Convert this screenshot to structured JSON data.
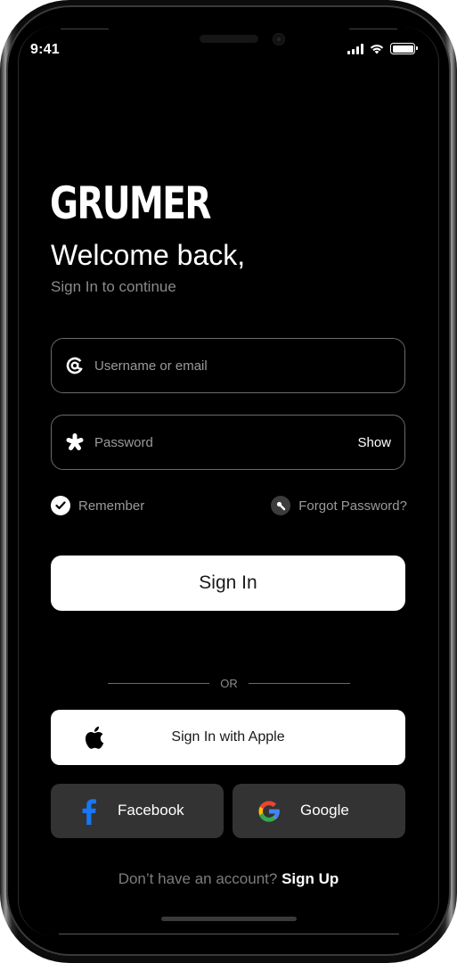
{
  "status_bar": {
    "time": "9:41",
    "icons": [
      "cellular-signal-icon",
      "wifi-icon",
      "battery-icon"
    ]
  },
  "brand": {
    "logo_text": "GRUMER"
  },
  "header": {
    "title": "Welcome back,",
    "subtitle": "Sign In to continue"
  },
  "form": {
    "username": {
      "placeholder": "Username or email",
      "value": "",
      "icon": "at-sign-icon"
    },
    "password": {
      "placeholder": "Password",
      "value": "",
      "icon": "asterisk-icon",
      "toggle_label": "Show"
    },
    "remember": {
      "label": "Remember",
      "checked": true,
      "icon": "check-circle-icon"
    },
    "forgot": {
      "label": "Forgot Password?",
      "icon": "key-icon"
    },
    "submit_label": "Sign In"
  },
  "divider": {
    "label": "OR"
  },
  "social": {
    "apple": {
      "label": "Sign In with Apple",
      "icon": "apple-icon"
    },
    "facebook": {
      "label": "Facebook",
      "icon": "facebook-icon",
      "color": "#1877F2"
    },
    "google": {
      "label": "Google",
      "icon": "google-icon",
      "colors": [
        "#4285F4",
        "#34A853",
        "#FBBC05",
        "#EA4335"
      ]
    }
  },
  "footer": {
    "prompt": "Don’t have an account?",
    "link_label": "Sign Up"
  },
  "colors": {
    "background": "#000000",
    "primary_button": "#FFFFFF",
    "social_button": "#333333",
    "field_border": "#6B6B6B",
    "muted_text": "#8A8A8A"
  }
}
